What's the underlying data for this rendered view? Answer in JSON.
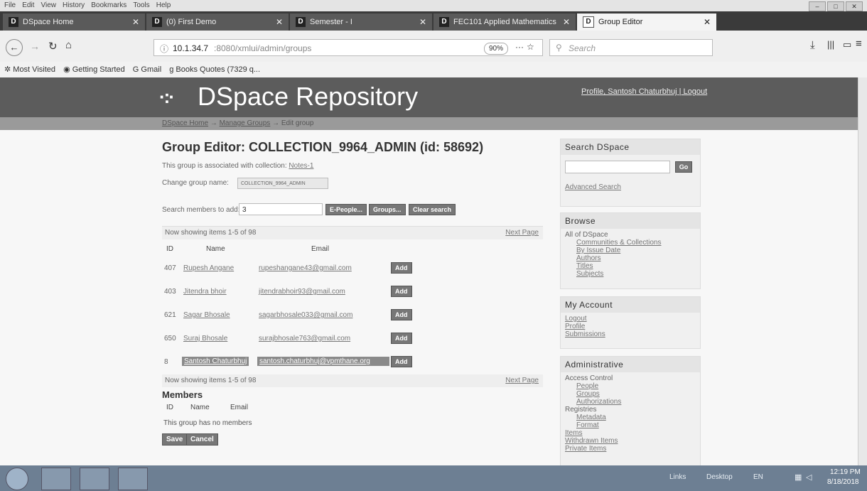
{
  "menu": [
    "File",
    "Edit",
    "View",
    "History",
    "Bookmarks",
    "Tools",
    "Help"
  ],
  "tabs": [
    {
      "label": "DSpace Home",
      "icon": "D"
    },
    {
      "label": "(0) First Demo",
      "icon": "D"
    },
    {
      "label": "Semester - I",
      "icon": "D"
    },
    {
      "label": "FEC101 Applied Mathematics",
      "icon": "D"
    },
    {
      "label": "Group Editor",
      "icon": "D",
      "active": true
    }
  ],
  "nav": {
    "url_host": "10.1.34.7",
    "url_rest": ":8080/xmlui/admin/groups",
    "zoom": "90%",
    "search_placeholder": "Search"
  },
  "bookmarks": [
    "Most Visited",
    "Getting Started",
    "Gmail",
    "Books Quotes (7329 q..."
  ],
  "site": {
    "title": "DSpace Repository",
    "user_links": "Profile, Santosh Chaturbhuj | Logout",
    "trail_home": "DSpace Home",
    "trail_groups": "Manage Groups",
    "trail_current": "Edit group"
  },
  "editor": {
    "heading": "Group Editor: COLLECTION_9964_ADMIN (id: 58692)",
    "assoc_prefix": "This group is associated with collection: ",
    "assoc_link": "Notes-1",
    "change_label": "Change group name:",
    "group_name": "COLLECTION_9964_ADMIN",
    "search_label": "Search members to add:",
    "search_value": "3",
    "btn_epeople": "E-People...",
    "btn_groups": "Groups...",
    "btn_clear": "Clear search",
    "showing": "Now showing items 1-5 of 98",
    "next_page": "Next Page",
    "col_id": "ID",
    "col_name": "Name",
    "col_email": "Email",
    "add_label": "Add",
    "rows": [
      {
        "id": "407",
        "name": "Rupesh Angane",
        "email": "rupeshangane43@gmail.com"
      },
      {
        "id": "403",
        "name": "Jitendra bhoir",
        "email": "jitendrabhoir93@gmail.com"
      },
      {
        "id": "621",
        "name": "Sagar Bhosale",
        "email": "sagarbhosale033@gmail.com"
      },
      {
        "id": "650",
        "name": "Suraj Bhosale",
        "email": "surajbhosale763@gmail.com"
      },
      {
        "id": "8",
        "name": "Santosh Chaturbhuj",
        "email": "santosh.chaturbhuj@vpmthane.org"
      }
    ],
    "members_heading": "Members",
    "no_members": "This group has no members",
    "save": "Save",
    "cancel": "Cancel"
  },
  "sidebar": {
    "search_title": "Search DSpace",
    "go": "Go",
    "advanced": "Advanced Search",
    "browse_title": "Browse",
    "browse_all": "All of DSpace",
    "browse_items": [
      "Communities & Collections",
      "By Issue Date",
      "Authors",
      "Titles",
      "Subjects"
    ],
    "account_title": "My Account",
    "account_items": [
      "Logout",
      "Profile",
      "Submissions"
    ],
    "admin_title": "Administrative",
    "access_control": "Access Control",
    "access_items": [
      "People",
      "Groups",
      "Authorizations"
    ],
    "registries": "Registries",
    "registry_items": [
      "Metadata",
      "Format"
    ],
    "admin_items": [
      "Items",
      "Withdrawn Items",
      "Private Items"
    ]
  },
  "taskbar": {
    "links": "Links",
    "desktop": "Desktop",
    "lang": "EN",
    "time": "12:19 PM",
    "date": "8/18/2018"
  }
}
